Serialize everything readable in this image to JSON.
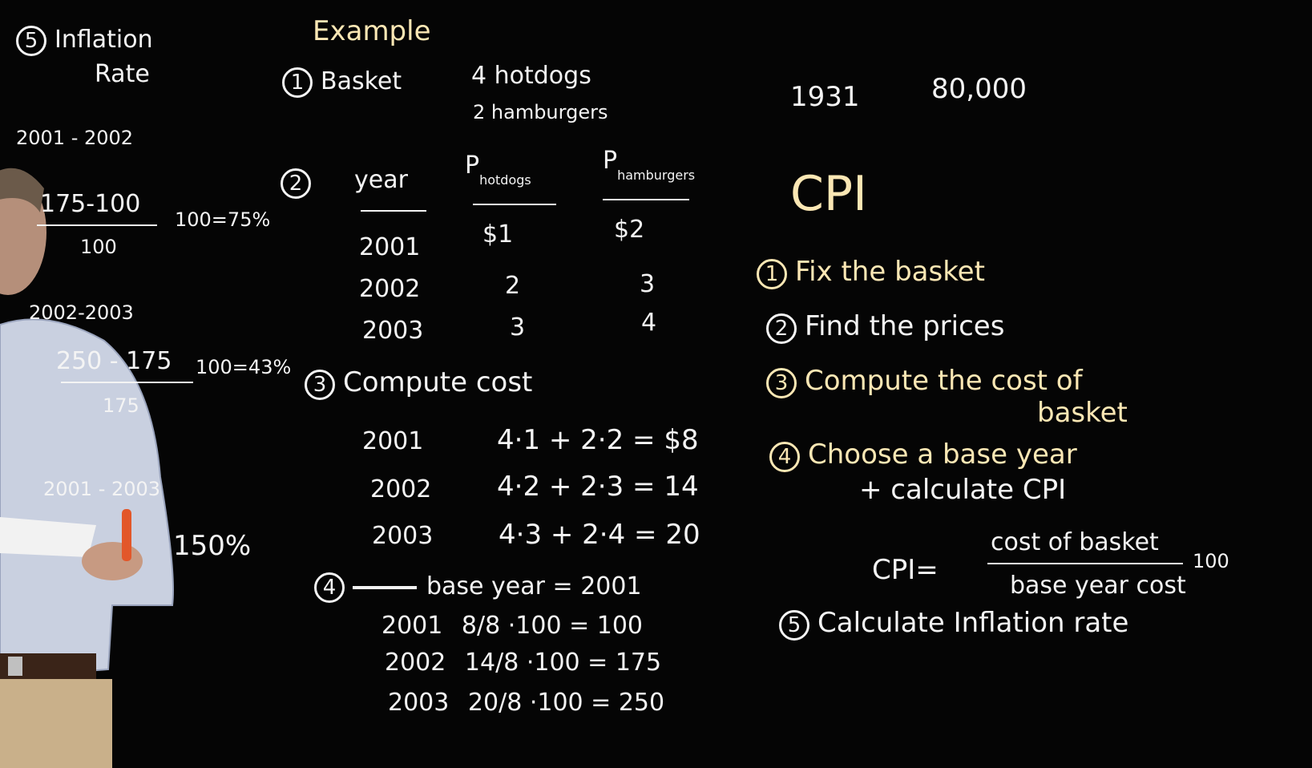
{
  "left": {
    "heading_num": "5",
    "heading_l1": "Inflation",
    "heading_l2": "Rate",
    "p1": "2001 - 2002",
    "p1_num": "175-100",
    "p1_den": "100",
    "p1_res": "100=75%",
    "p2": "2002-2003",
    "p2_num": "250 - 175",
    "p2_den": "175",
    "p2_res": "100=43%",
    "p3": "2001 - 2003",
    "p3_res": "150%"
  },
  "example": {
    "title": "Example",
    "s1_num": "1",
    "s1_label": "Basket",
    "basket_1": "4 hotdogs",
    "basket_2": "2 hamburgers",
    "s2_num": "2",
    "col_year": "year",
    "col_hot": "P",
    "col_hot_sub": "hotdogs",
    "col_ham": "P",
    "col_ham_sub": "hamburgers",
    "rows": [
      {
        "year": "2001",
        "hot": "$1",
        "ham": "$2"
      },
      {
        "year": "2002",
        "hot": "2",
        "ham": "3"
      },
      {
        "year": "2003",
        "hot": "3",
        "ham": "4"
      }
    ],
    "s3_num": "3",
    "s3_label": "Compute cost",
    "costs": [
      {
        "year": "2001",
        "expr": "4·1 + 2·2 = $8"
      },
      {
        "year": "2002",
        "expr": "4·2 + 2·3 = 14"
      },
      {
        "year": "2003",
        "expr": "4·3 + 2·4 = 20"
      }
    ],
    "s4_num": "4",
    "s4_label": "base year = 2001",
    "cpi_rows": [
      {
        "year": "2001",
        "frac_n": "8",
        "frac_d": "8",
        "rest": "·100 = 100"
      },
      {
        "year": "2002",
        "frac_n": "14",
        "frac_d": "8",
        "rest": "·100 = 175"
      },
      {
        "year": "2003",
        "frac_n": "20",
        "frac_d": "8",
        "rest": "·100 = 250"
      }
    ]
  },
  "right": {
    "year": "1931",
    "amount": "80,000",
    "cpi_title": "CPI",
    "steps": [
      {
        "num": "1",
        "text": "Fix the basket"
      },
      {
        "num": "2",
        "text": "Find the prices"
      },
      {
        "num": "3",
        "text": "Compute the cost of",
        "text2": "basket"
      },
      {
        "num": "4",
        "text": "Choose a base year",
        "text2": "+ calculate CPI"
      },
      {
        "num": "5",
        "text": "Calculate Inflation rate"
      }
    ],
    "formula_lhs": "CPI=",
    "formula_num": "cost of basket",
    "formula_den": "base year cost",
    "formula_mult": "100"
  }
}
